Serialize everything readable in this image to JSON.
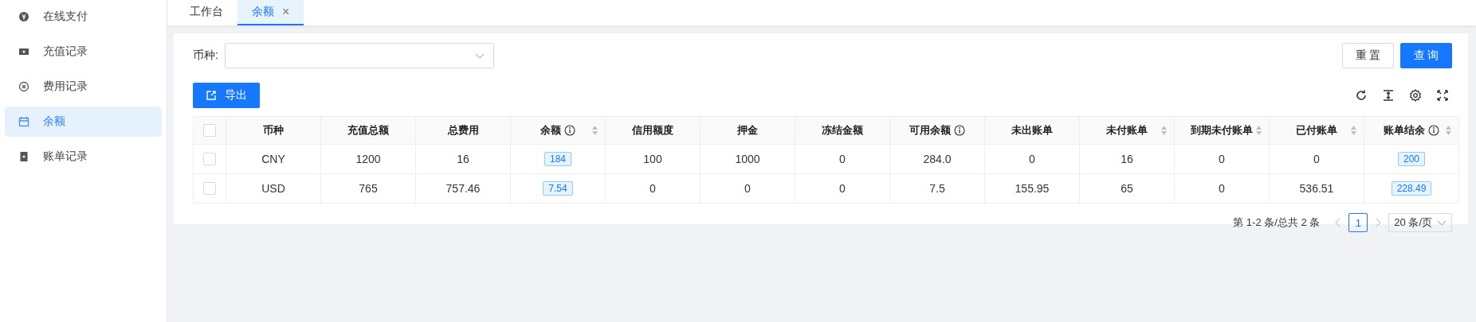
{
  "sidebar": {
    "items": [
      {
        "label": "在线支付",
        "selected": false
      },
      {
        "label": "充值记录",
        "selected": false
      },
      {
        "label": "费用记录",
        "selected": false
      },
      {
        "label": "余额",
        "selected": true
      },
      {
        "label": "账单记录",
        "selected": false
      }
    ]
  },
  "tabs": [
    {
      "label": "工作台",
      "selected": false,
      "closable": false
    },
    {
      "label": "余额",
      "selected": true,
      "closable": true,
      "close_glyph": "×"
    }
  ],
  "filter": {
    "label": "币种:"
  },
  "buttons": [
    {
      "label": "重 置",
      "kind": "default"
    },
    {
      "label": "查 询",
      "kind": "primary"
    }
  ],
  "export_button": {
    "label": "导出"
  },
  "table": {
    "header_checked": false,
    "columns": [
      {
        "label": "币种",
        "info": false,
        "sortable": false,
        "kind": "text"
      },
      {
        "label": "充值总额",
        "info": false,
        "sortable": false,
        "kind": "text"
      },
      {
        "label": "总费用",
        "info": false,
        "sortable": false,
        "kind": "text"
      },
      {
        "label": "余额",
        "info": true,
        "sortable": true,
        "kind": "tag"
      },
      {
        "label": "信用额度",
        "info": false,
        "sortable": false,
        "kind": "text"
      },
      {
        "label": "押金",
        "info": false,
        "sortable": false,
        "kind": "text"
      },
      {
        "label": "冻结金额",
        "info": false,
        "sortable": false,
        "kind": "text"
      },
      {
        "label": "可用余额",
        "info": true,
        "sortable": false,
        "kind": "text"
      },
      {
        "label": "未出账单",
        "info": false,
        "sortable": false,
        "kind": "text"
      },
      {
        "label": "未付账单",
        "info": false,
        "sortable": true,
        "kind": "text"
      },
      {
        "label": "到期未付账单",
        "info": false,
        "sortable": true,
        "kind": "text"
      },
      {
        "label": "已付账单",
        "info": false,
        "sortable": true,
        "kind": "text"
      },
      {
        "label": "账单结余",
        "info": true,
        "sortable": true,
        "kind": "tag"
      }
    ],
    "rows": [
      {
        "checked": false,
        "cells": [
          "CNY",
          "1200",
          "16",
          "184",
          "100",
          "1000",
          "0",
          "284.0",
          "0",
          "16",
          "0",
          "0",
          "200"
        ]
      },
      {
        "checked": false,
        "cells": [
          "USD",
          "765",
          "757.46",
          "7.54",
          "0",
          "0",
          "0",
          "7.5",
          "155.95",
          "65",
          "0",
          "536.51",
          "228.49"
        ]
      }
    ]
  },
  "pagination": {
    "summary": "第 1-2 条/总共 2 条",
    "pages": [
      {
        "label": "1",
        "selected": true
      }
    ],
    "page_size": "20 条/页"
  }
}
